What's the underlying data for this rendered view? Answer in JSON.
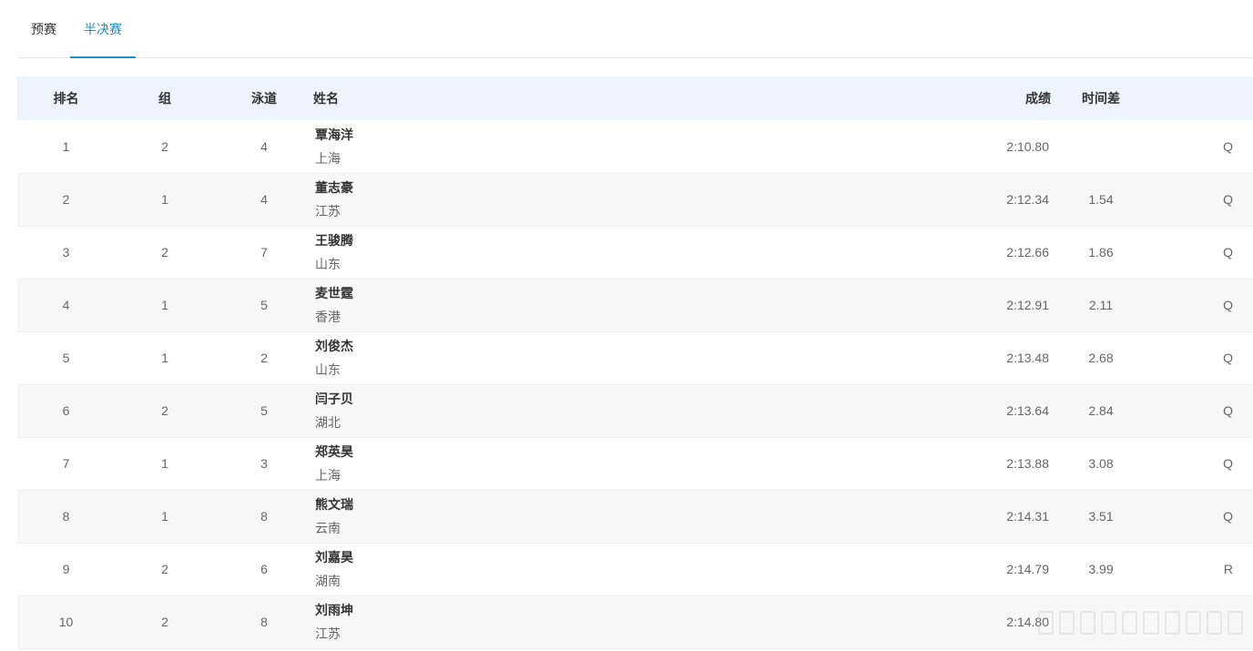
{
  "tabs": [
    {
      "label": "预赛",
      "active": false
    },
    {
      "label": "半决赛",
      "active": true
    }
  ],
  "table": {
    "headers": {
      "rank": "排名",
      "group": "组",
      "lane": "泳道",
      "name": "姓名",
      "score": "成绩",
      "diff": "时间差",
      "flag": ""
    },
    "rows": [
      {
        "rank": "1",
        "group": "2",
        "lane": "4",
        "name": "覃海洋",
        "province": "上海",
        "score": "2:10.80",
        "diff": "",
        "flag": "Q"
      },
      {
        "rank": "2",
        "group": "1",
        "lane": "4",
        "name": "董志豪",
        "province": "江苏",
        "score": "2:12.34",
        "diff": "1.54",
        "flag": "Q"
      },
      {
        "rank": "3",
        "group": "2",
        "lane": "7",
        "name": "王骏腾",
        "province": "山东",
        "score": "2:12.66",
        "diff": "1.86",
        "flag": "Q"
      },
      {
        "rank": "4",
        "group": "1",
        "lane": "5",
        "name": "麦世霆",
        "province": "香港",
        "score": "2:12.91",
        "diff": "2.11",
        "flag": "Q"
      },
      {
        "rank": "5",
        "group": "1",
        "lane": "2",
        "name": "刘俊杰",
        "province": "山东",
        "score": "2:13.48",
        "diff": "2.68",
        "flag": "Q"
      },
      {
        "rank": "6",
        "group": "2",
        "lane": "5",
        "name": "闫子贝",
        "province": "湖北",
        "score": "2:13.64",
        "diff": "2.84",
        "flag": "Q"
      },
      {
        "rank": "7",
        "group": "1",
        "lane": "3",
        "name": "郑英昊",
        "province": "上海",
        "score": "2:13.88",
        "diff": "3.08",
        "flag": "Q"
      },
      {
        "rank": "8",
        "group": "1",
        "lane": "8",
        "name": "熊文瑞",
        "province": "云南",
        "score": "2:14.31",
        "diff": "3.51",
        "flag": "Q"
      },
      {
        "rank": "9",
        "group": "2",
        "lane": "6",
        "name": "刘嘉昊",
        "province": "湖南",
        "score": "2:14.79",
        "diff": "3.99",
        "flag": "R"
      },
      {
        "rank": "10",
        "group": "2",
        "lane": "8",
        "name": "刘雨坤",
        "province": "江苏",
        "score": "2:14.80",
        "diff": "",
        "flag": ""
      }
    ]
  },
  "colors": {
    "accent": "#1f8fc9",
    "header_bg": "#edf4fd",
    "stripe_bg": "#f7f7f7"
  }
}
